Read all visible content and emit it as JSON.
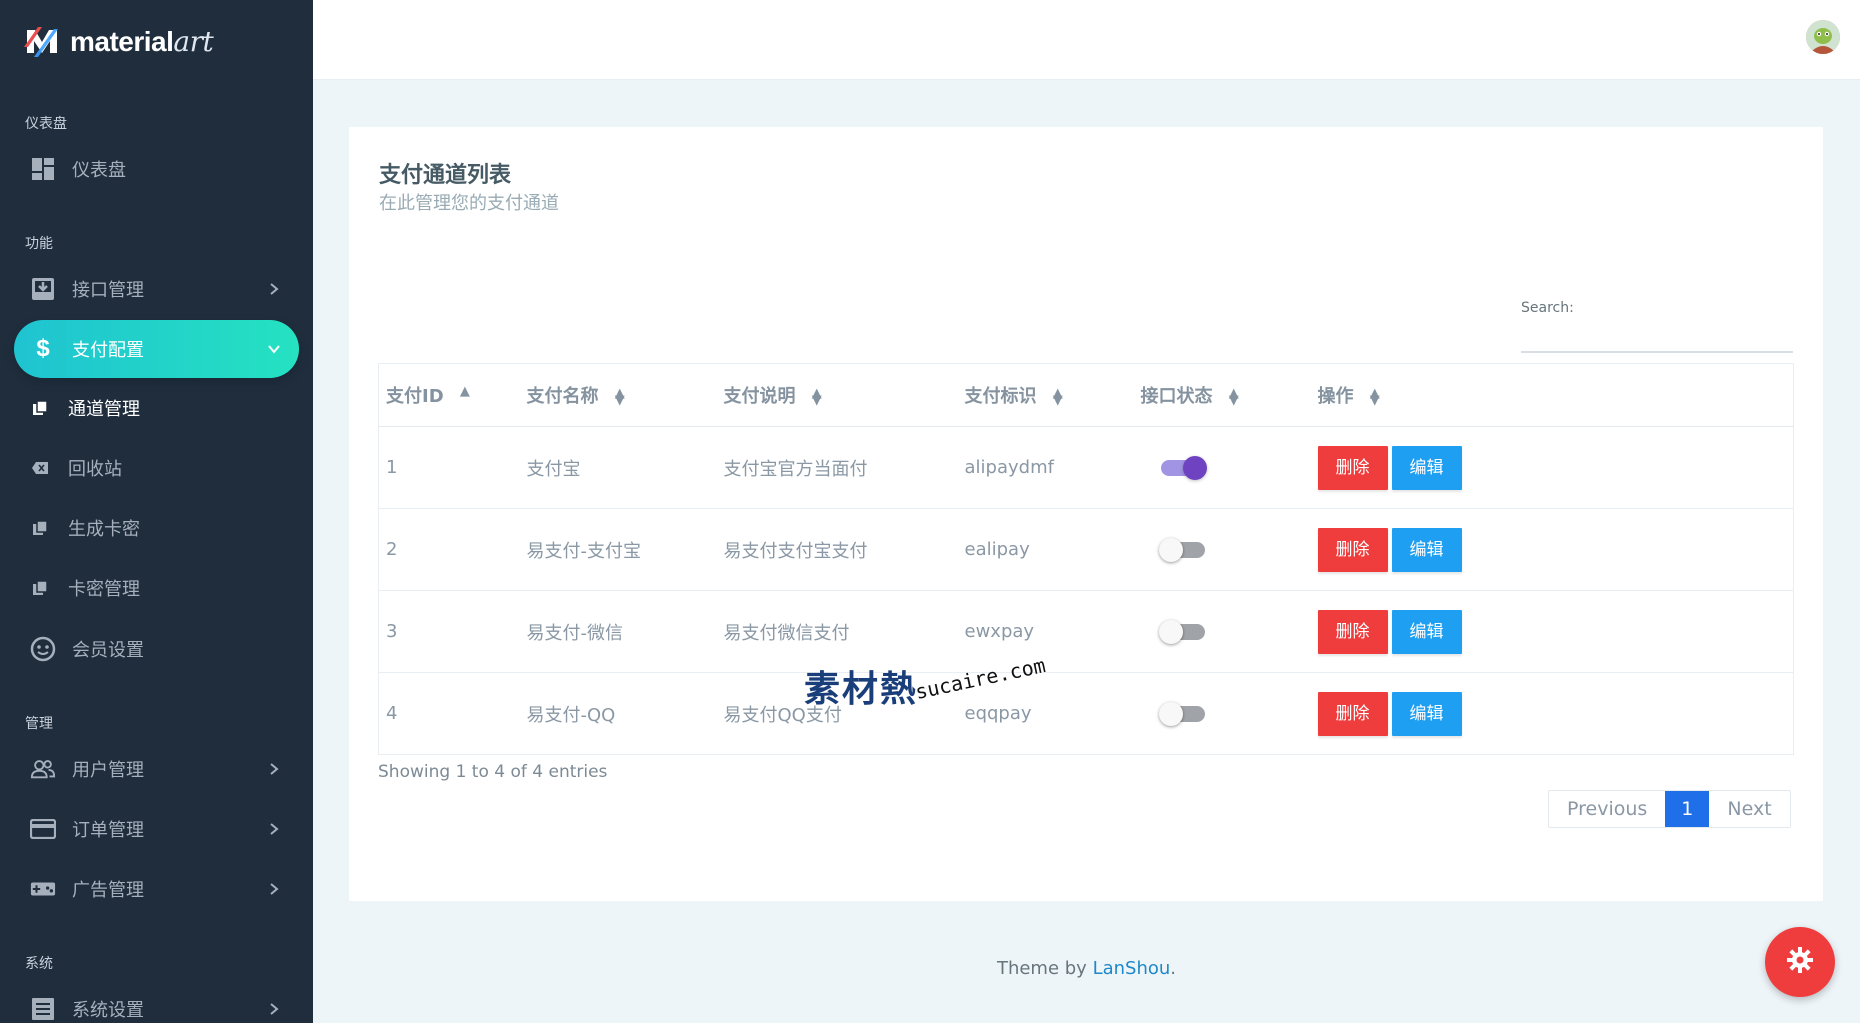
{
  "brand": {
    "name_bold": "material",
    "name_script": "art"
  },
  "sidebar": {
    "sections": {
      "dashboard": "仪表盘",
      "features": "功能",
      "manage": "管理",
      "system": "系统"
    },
    "items": {
      "dashboard": "仪表盘",
      "api": "接口管理",
      "payment": "支付配置",
      "channel": "通道管理",
      "recycle": "回收站",
      "gen_card": "生成卡密",
      "card_manage": "卡密管理",
      "member": "会员设置",
      "users": "用户管理",
      "orders": "订单管理",
      "ads": "广告管理",
      "settings": "系统设置"
    }
  },
  "card": {
    "title": "支付通道列表",
    "subtitle": "在此管理您的支付通道"
  },
  "search": {
    "label": "Search:",
    "value": ""
  },
  "table": {
    "headers": [
      "支付ID",
      "支付名称",
      "支付说明",
      "支付标识",
      "接口状态",
      "操作"
    ],
    "rows": [
      {
        "id": "1",
        "name": "支付宝",
        "desc": "支付宝官方当面付",
        "key": "alipaydmf",
        "enabled": true
      },
      {
        "id": "2",
        "name": "易支付-支付宝",
        "desc": "易支付支付宝支付",
        "key": "ealipay",
        "enabled": false
      },
      {
        "id": "3",
        "name": "易支付-微信",
        "desc": "易支付微信支付",
        "key": "ewxpay",
        "enabled": false
      },
      {
        "id": "4",
        "name": "易支付-QQ",
        "desc": "易支付QQ支付",
        "key": "eqqpay",
        "enabled": false
      }
    ],
    "actions": {
      "delete": "删除",
      "edit": "编辑"
    }
  },
  "info": "Showing 1 to 4 of 4 entries",
  "pagination": {
    "previous": "Previous",
    "current": "1",
    "next": "Next"
  },
  "watermark": {
    "big": "素材熱",
    "small": "sucaire.com"
  },
  "footer": {
    "prefix": "Theme by ",
    "link": "LanShou",
    "suffix": "."
  },
  "colors": {
    "sidebar": "#1f2d3d",
    "active_gradient_start": "#1fc3d1",
    "active_gradient_end": "#25e2c1",
    "delete": "#ef3d3d",
    "edit": "#1e9ff2",
    "toggle_on": "#6f42c1",
    "page_active": "#1f6fe8"
  }
}
